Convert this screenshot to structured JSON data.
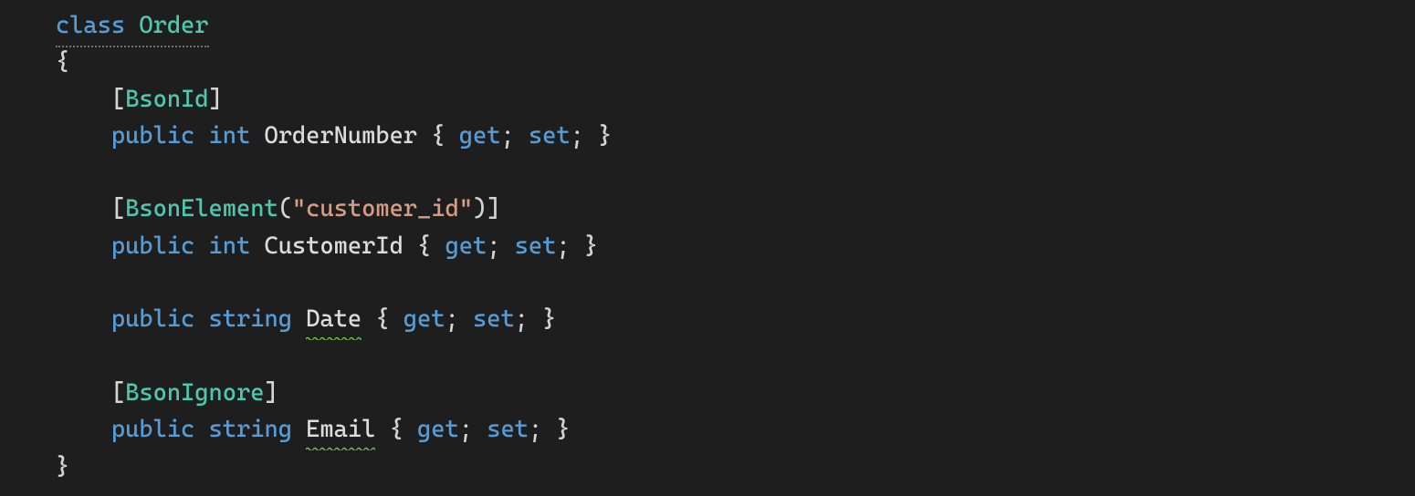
{
  "indent1": "    ",
  "indent2": "        ",
  "kw_class": "class",
  "class_name": "Order",
  "brace_open": "{",
  "brace_close": "}",
  "lbracket": "[",
  "rbracket": "]",
  "lparen": "(",
  "rparen": ")",
  "attr_BsonId": "BsonId",
  "attr_BsonElement": "BsonElement",
  "attr_BsonIgnore": "BsonIgnore",
  "str_customer_id": "\"customer_id\"",
  "kw_public": "public",
  "kw_int": "int",
  "kw_string": "string",
  "kw_get": "get",
  "kw_set": "set",
  "semi": ";",
  "sp": " ",
  "prop_OrderNumber": "OrderNumber",
  "prop_CustomerId": "CustomerId",
  "prop_Date": "Date",
  "prop_Email": "Email"
}
